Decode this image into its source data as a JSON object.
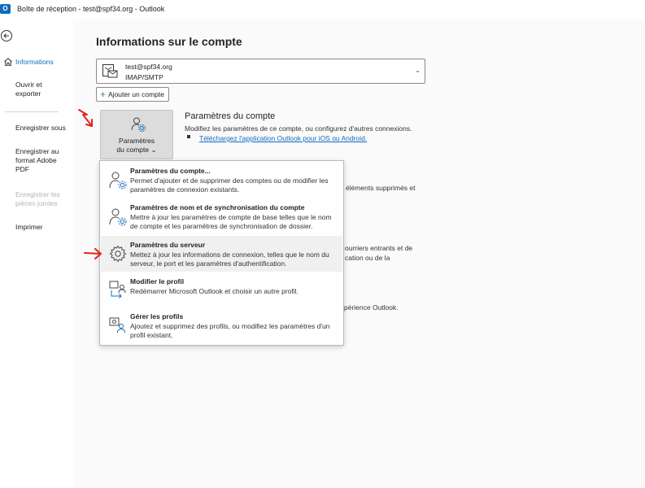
{
  "window": {
    "title": "Boîte de réception - test@spf34.org  -  Outlook",
    "app_icon": "outlook-logo-icon",
    "app_icon_letter": "O"
  },
  "sidebar": {
    "back_icon": "back-arrow-icon",
    "items": [
      {
        "label": "Informations",
        "icon": "home-icon",
        "state": "active"
      },
      {
        "label": "Ouvrir et exporter",
        "state": "normal"
      },
      {
        "label": "Enregistrer sous",
        "state": "normal"
      },
      {
        "label": "Enregistrer au format Adobe PDF",
        "state": "normal"
      },
      {
        "label": "Enregistrer les pièces jointes",
        "state": "disabled"
      },
      {
        "label": "Imprimer",
        "state": "normal"
      }
    ]
  },
  "main": {
    "title": "Informations sur le compte",
    "account": {
      "email": "test@spf34.org",
      "type": "IMAP/SMTP",
      "chevron": "⌄"
    },
    "add_account_label": "Ajouter un compte",
    "settings_tile": {
      "line1": "Paramètres",
      "line2": "du compte ⌄"
    },
    "section": {
      "title": "Paramètres du compte",
      "description": "Modifiez les paramètres de ce compte, ou configurez d'autres connexions.",
      "link": "Téléchargez l'application Outlook pour iOS ou Android."
    },
    "partial_texts": [
      "éléments supprimés et",
      "ourriers entrants et de",
      "cation ou de la",
      "périence Outlook."
    ]
  },
  "dropdown": {
    "items": [
      {
        "title": "Paramètres du compte...",
        "description": "Permet d'ajouter et de supprimer des comptes ou de modifier les paramètres de connexion existants.",
        "icon": "account-settings-icon"
      },
      {
        "title": "Paramètres de nom et de synchronisation du compte",
        "description": "Mettre à jour les paramètres de compte de base telles que le nom de compte et les paramètres de synchronisation de dossier.",
        "icon": "account-sync-icon"
      },
      {
        "title": "Paramètres du serveur",
        "description": "Mettez à jour les informations de connexion, telles que le nom du serveur, le port et les paramètres d'authentification.",
        "icon": "server-settings-gear-icon"
      },
      {
        "title": "Modifier le profil",
        "description": "Redémarrer Microsoft Outlook et choisir un autre profil.",
        "icon": "change-profile-icon"
      },
      {
        "title": "Gérer les profils",
        "description": "Ajoutez et supprimez des profils, ou modifiez les paramètres d'un profil existant.",
        "icon": "manage-profiles-icon"
      }
    ]
  },
  "colors": {
    "accent": "#0f6cbd",
    "annotation": "#e0231c",
    "tile_bg": "#dcdcdc"
  }
}
